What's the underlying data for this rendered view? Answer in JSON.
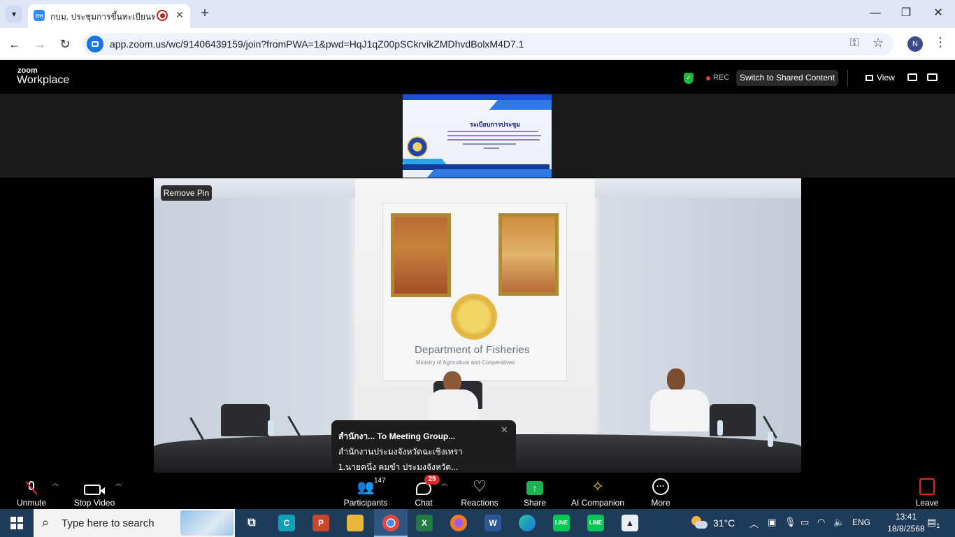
{
  "browser": {
    "tab_title": "กบม. ประชุมการขึ้นทะเบียนฟาร์ม",
    "tab_favicon_label": "zm",
    "url": "app.zoom.us/wc/91406439159/join?fromPWA=1&pwd=HqJ1qZ00pSCkrvikZMDhvdBolxM4D7.1",
    "profile_initial": "N"
  },
  "zoom": {
    "logo_top": "zoom",
    "logo_bottom": "Workplace",
    "rec_label": "REC",
    "switch_label": "Switch to Shared Content",
    "view_label": "View",
    "remove_pin_label": "Remove Pin",
    "shared_slide": {
      "title": "ระเบียบการประชุม"
    },
    "video": {
      "wall_text": "Department of Fisheries",
      "wall_subtext": "Ministry of Agriculture and Cooperatives"
    },
    "chat_notification": {
      "header": "สำนักงา... To Meeting Group...",
      "line1": "สำนักงานประมงจังหวัดฉะเชิงเทรา",
      "line2": "1.นายคนึ่ง คมขำ ประมงจังหวัด..."
    },
    "toolbar": {
      "unmute": "Unmute",
      "stop_video": "Stop Video",
      "participants": "Participants",
      "participants_count": "147",
      "chat": "Chat",
      "chat_badge": "29",
      "reactions": "Reactions",
      "share": "Share",
      "ai_companion": "AI Companion",
      "more": "More",
      "leave": "Leave"
    }
  },
  "taskbar": {
    "search_placeholder": "Type here to search",
    "weather_temp": "31°C",
    "language": "ENG",
    "time": "13:41",
    "date": "18/8/2568",
    "notification_count": "1"
  },
  "colors": {
    "zoom_bg": "#000000",
    "rec_red": "#ee3b3b",
    "share_green": "#1db254",
    "badge_red": "#e02828",
    "taskbar": "#1f3b5a"
  }
}
